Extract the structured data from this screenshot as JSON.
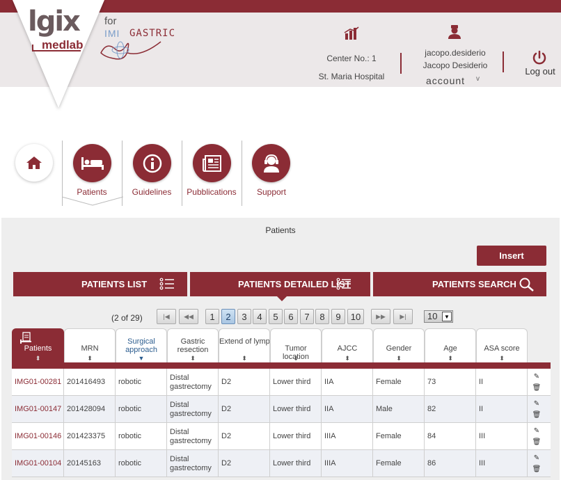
{
  "header": {
    "logo_main": "lgix",
    "logo_sub": "medlab",
    "for_label": "for",
    "product_prefix": "IMI",
    "product_name": "GASTRIC",
    "center_no": "Center No.: 1",
    "hospital": "St. Maria Hospital",
    "username": "jacopo.desiderio",
    "fullname": "Jacopo Desiderio",
    "account_label": "account",
    "account_caret": "v",
    "logout_label": "Log out"
  },
  "nav": {
    "items": [
      {
        "label": "",
        "icon": "home-icon"
      },
      {
        "label": "Patients",
        "icon": "bed-icon"
      },
      {
        "label": "Guidelines",
        "icon": "info-icon"
      },
      {
        "label": "Pubblications",
        "icon": "newspaper-icon"
      },
      {
        "label": "Support",
        "icon": "headset-icon"
      }
    ]
  },
  "content": {
    "section_title": "Patients",
    "insert_label": "Insert",
    "tabs": [
      {
        "label": "PATIENTS LIST",
        "icon": "list-icon"
      },
      {
        "label": "PATIENTS DETAILED LIST",
        "icon": "list-icon"
      },
      {
        "label": "PATIENTS SEARCH",
        "icon": "search-icon"
      }
    ]
  },
  "pagination": {
    "count": "(2 of 29)",
    "first": "|◀",
    "prev": "◀◀",
    "pages": [
      "1",
      "2",
      "3",
      "4",
      "5",
      "6",
      "7",
      "8",
      "9",
      "10"
    ],
    "current": "2",
    "next": "▶▶",
    "last": "▶|",
    "page_size": "10"
  },
  "table": {
    "columns": [
      "Patients",
      "MRN",
      "Surgical approach",
      "Gastric resection",
      "Extend of lymphadenectomy",
      "Tumor location",
      "AJCC",
      "Gender",
      "Age",
      "ASA score"
    ],
    "rows": [
      [
        "IMG01-00281",
        "201416493",
        "robotic",
        "Distal gastrectomy",
        "D2",
        "Lower third",
        "IIA",
        "Female",
        "73",
        "II"
      ],
      [
        "IMG01-00147",
        "201428094",
        "robotic",
        "Distal gastrectomy",
        "D2",
        "Lower third",
        "IIA",
        "Male",
        "82",
        "II"
      ],
      [
        "IMG01-00146",
        "201423375",
        "robotic",
        "Distal gastrectomy",
        "D2",
        "Lower third",
        "IIIA",
        "Female",
        "84",
        "III"
      ],
      [
        "IMG01-00104",
        "20145163",
        "robotic",
        "Distal gastrectomy",
        "D2",
        "Lower third",
        "IIIA",
        "Female",
        "86",
        "III"
      ]
    ]
  },
  "colors": {
    "brand": "#8b2c35",
    "header_bg": "#ece8e9",
    "row_alt": "#eef0f5"
  }
}
